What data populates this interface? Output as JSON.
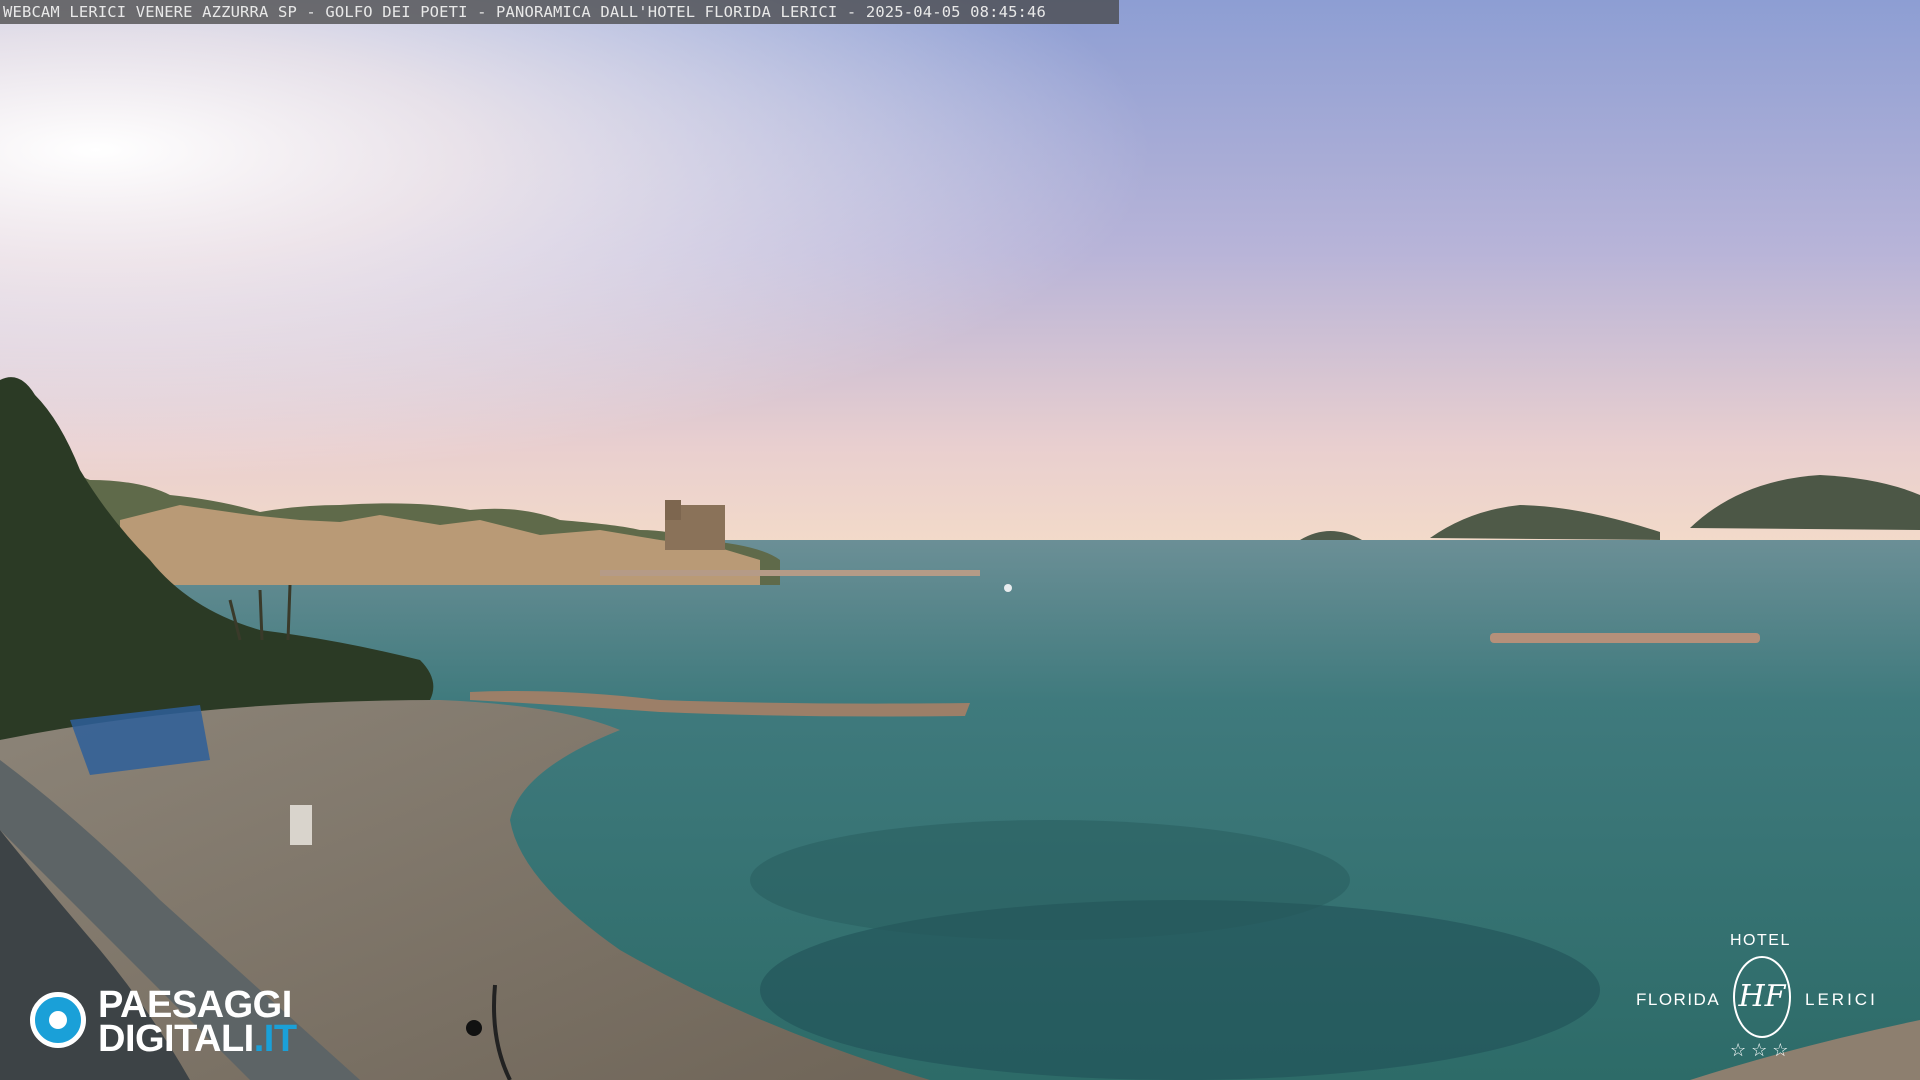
{
  "overlay": {
    "caption": "WEBCAM LERICI VENERE AZZURRA SP - GOLFO DEI POETI - PANORAMICA DALL'HOTEL FLORIDA LERICI - 2025-04-05 08:45:46"
  },
  "brand_logo": {
    "line1": "PAESAGGI",
    "line2_main": "DIGITALI",
    "line2_suffix": ".IT",
    "icon": "camera-eye-icon"
  },
  "hotel_logo": {
    "top": "HOTEL",
    "left": "FLORIDA",
    "right": "LERICI",
    "monogram": "HF",
    "stars": "☆☆☆"
  },
  "colors": {
    "brand_accent": "#1aa0d8",
    "sea": "#2f6e6e",
    "sky_top": "#8e9ed0",
    "sky_horizon": "#f2d6c8"
  }
}
